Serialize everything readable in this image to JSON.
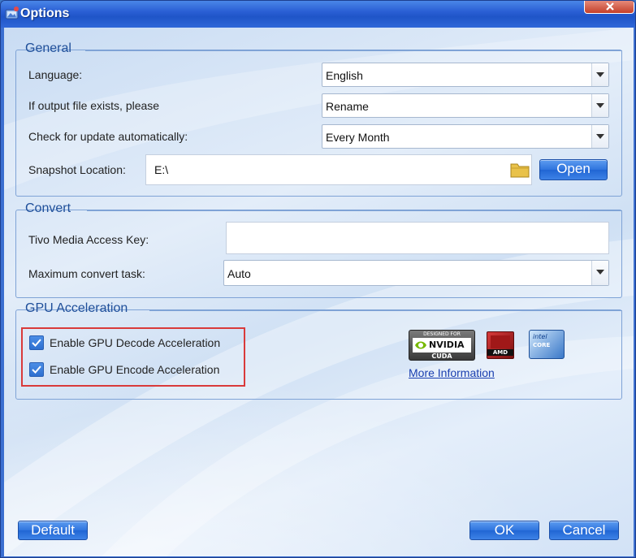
{
  "window": {
    "title": "Options"
  },
  "general": {
    "legend": "General",
    "language_label": "Language:",
    "language_value": "English",
    "output_exists_label": "If output file exists, please",
    "output_exists_value": "Rename",
    "update_label": "Check for update automatically:",
    "update_value": "Every Month",
    "snapshot_label": "Snapshot Location:",
    "snapshot_value": "E:\\",
    "open_label": "Open"
  },
  "convert": {
    "legend": "Convert",
    "tivo_label": "Tivo Media Access Key:",
    "tivo_value": "",
    "max_task_label": "Maximum convert task:",
    "max_task_value": "Auto"
  },
  "gpu": {
    "legend": "GPU Acceleration",
    "decode_label": "Enable GPU Decode Acceleration",
    "decode_checked": true,
    "encode_label": "Enable GPU Encode Acceleration",
    "encode_checked": true,
    "more_info_label": "More Information",
    "nvidia_logo": {
      "top": "DESIGNED FOR",
      "brand": "NVIDIA",
      "bottom": "CUDA"
    },
    "amd_logo": {
      "brand": "AMD"
    },
    "intel_logo": {
      "brand": "intel",
      "sub": "CORE"
    }
  },
  "footer": {
    "default_label": "Default",
    "ok_label": "OK",
    "cancel_label": "Cancel"
  },
  "colors": {
    "accent": "#2f74de",
    "highlight": "#d93a3a",
    "link": "#1a3fb0"
  }
}
